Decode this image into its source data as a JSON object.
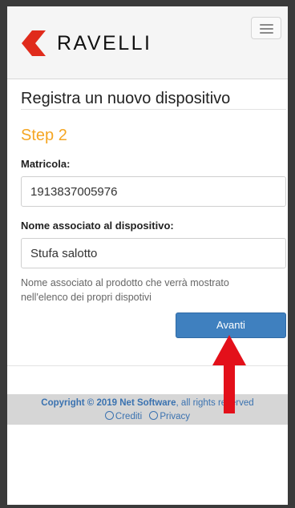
{
  "header": {
    "brand": "RAVELLI",
    "menu_icon": "hamburger-menu-icon"
  },
  "main": {
    "title": "Registra un nuovo dispositivo",
    "step": "Step 2",
    "serial": {
      "label": "Matricola:",
      "value": "1913837005976"
    },
    "device_name": {
      "label": "Nome associato al dispositivo:",
      "value": "Stufa salotto"
    },
    "help_text": "Nome associato al prodotto che verrà mostrato nell'elenco dei propri dispotivi",
    "next_label": "Avanti"
  },
  "footer": {
    "copyright_prefix": "Copyright © 2019 Net Software",
    "copyright_suffix": ", all rights reserved",
    "links": [
      "Crediti",
      "Privacy"
    ]
  },
  "colors": {
    "accent_step": "#f5a623",
    "primary_button": "#3f80bf",
    "annotation_arrow": "#e3101a",
    "logo_red": "#e02b1c"
  }
}
